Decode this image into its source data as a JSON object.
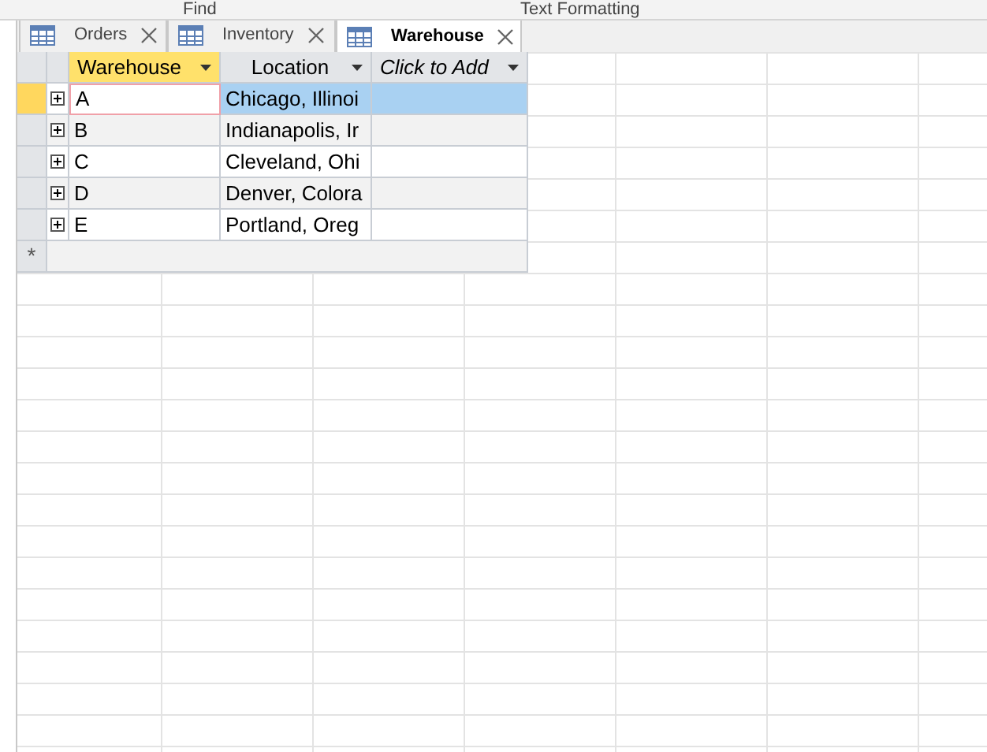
{
  "ribbon": {
    "groups": [
      "Find",
      "Text Formatting"
    ]
  },
  "tabs": [
    {
      "label": "Orders",
      "selected": false
    },
    {
      "label": "Inventory",
      "selected": false
    },
    {
      "label": "Warehouse",
      "selected": true
    }
  ],
  "table": {
    "columns": [
      {
        "label": "Warehouse",
        "kind": "field",
        "selected": true
      },
      {
        "label": "Location",
        "kind": "field",
        "selected": false
      },
      {
        "label": "Click to Add",
        "kind": "add",
        "selected": false
      }
    ],
    "rows": [
      {
        "selected": true,
        "cells": [
          "A",
          "Chicago, Illinoi",
          ""
        ]
      },
      {
        "selected": false,
        "cells": [
          "B",
          "Indianapolis, Ir",
          ""
        ]
      },
      {
        "selected": false,
        "cells": [
          "C",
          "Cleveland, Ohi",
          ""
        ]
      },
      {
        "selected": false,
        "cells": [
          "D",
          "Denver, Colora",
          ""
        ]
      },
      {
        "selected": false,
        "cells": [
          "E",
          "Portland, Oreg",
          ""
        ]
      }
    ],
    "new_row_marker": "*"
  }
}
